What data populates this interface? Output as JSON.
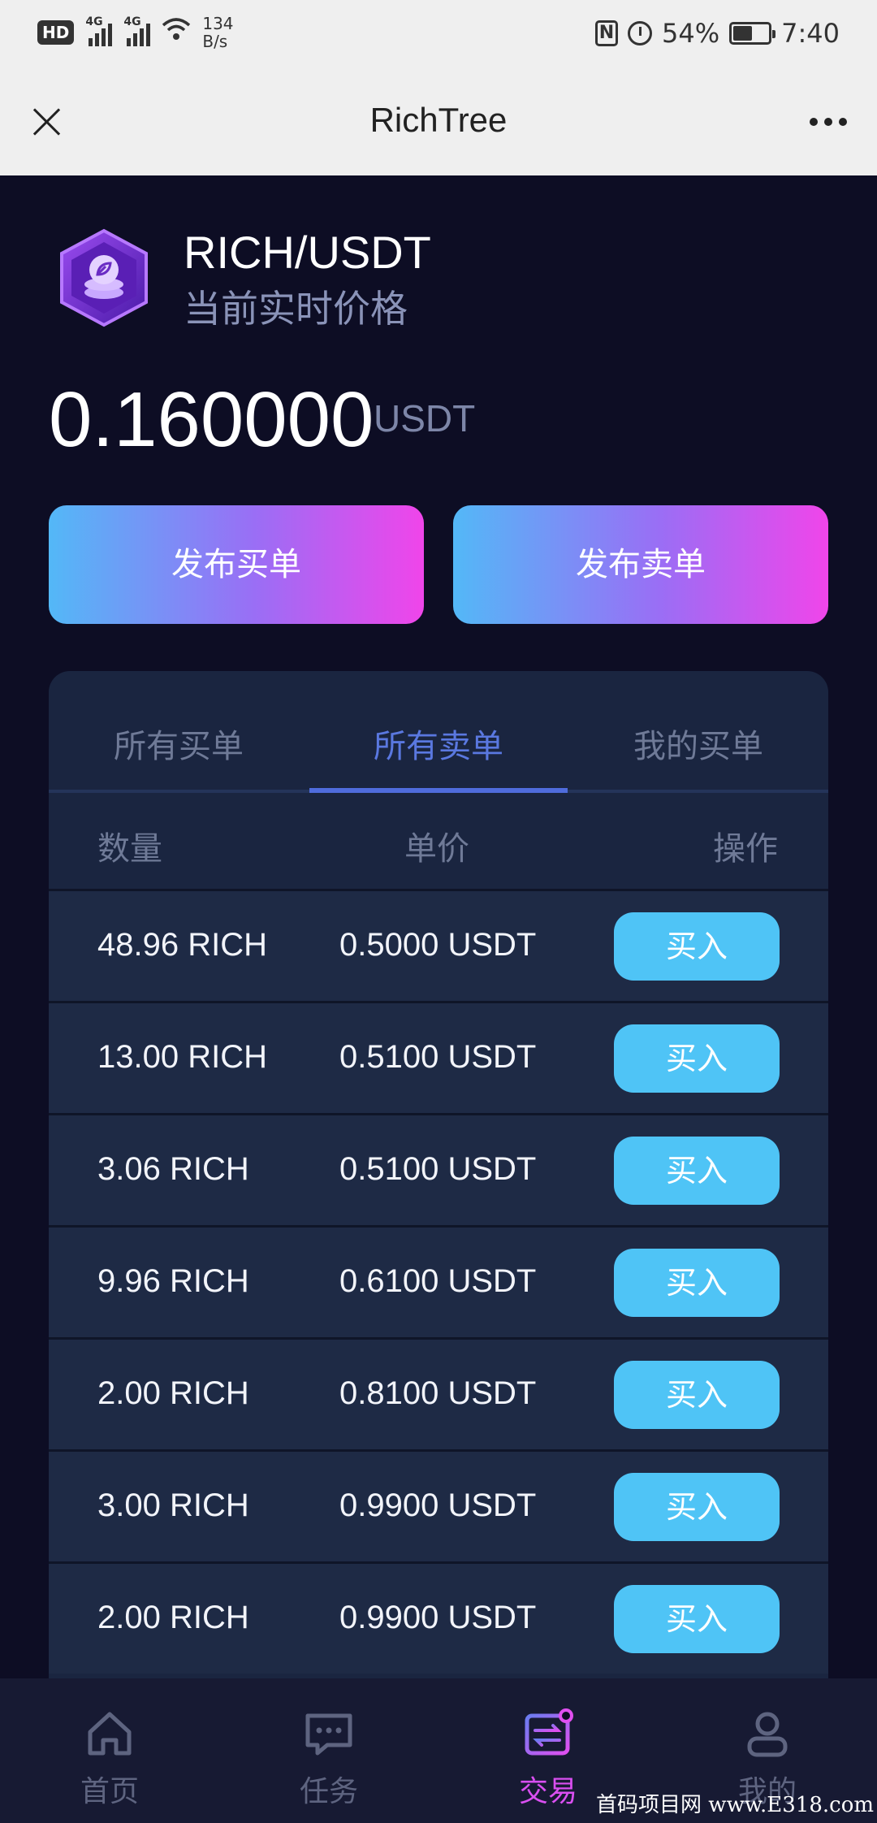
{
  "status_bar": {
    "hd": "HD",
    "net_type_1": "4G",
    "net_type_2": "4G",
    "net_speed_value": "134",
    "net_speed_unit": "B/s",
    "nfc": "N",
    "battery_percent": "54%",
    "battery_level": 0.54,
    "time": "7:40"
  },
  "titlebar": {
    "title": "RichTree"
  },
  "header": {
    "pair": "RICH/USDT",
    "subtitle": "当前实时价格",
    "price": "0.160000",
    "price_unit": "USDT"
  },
  "actions": {
    "buy_label": "发布买单",
    "sell_label": "发布卖单"
  },
  "tabs": [
    {
      "label": "所有买单",
      "active": false
    },
    {
      "label": "所有卖单",
      "active": true
    },
    {
      "label": "我的买单",
      "active": false
    }
  ],
  "table": {
    "headers": {
      "qty": "数量",
      "price": "单价",
      "action": "操作"
    },
    "rows": [
      {
        "qty": "48.96 RICH",
        "price": "0.5000 USDT",
        "action": "买入"
      },
      {
        "qty": "13.00 RICH",
        "price": "0.5100 USDT",
        "action": "买入"
      },
      {
        "qty": "3.06 RICH",
        "price": "0.5100 USDT",
        "action": "买入"
      },
      {
        "qty": "9.96 RICH",
        "price": "0.6100 USDT",
        "action": "买入"
      },
      {
        "qty": "2.00 RICH",
        "price": "0.8100 USDT",
        "action": "买入"
      },
      {
        "qty": "3.00 RICH",
        "price": "0.9900 USDT",
        "action": "买入"
      },
      {
        "qty": "2.00 RICH",
        "price": "0.9900 USDT",
        "action": "买入"
      }
    ]
  },
  "bottom_nav": [
    {
      "label": "首页",
      "icon": "home-icon",
      "active": false
    },
    {
      "label": "任务",
      "icon": "chat-icon",
      "active": false
    },
    {
      "label": "交易",
      "icon": "exchange-icon",
      "active": true
    },
    {
      "label": "我的",
      "icon": "user-icon",
      "active": false
    }
  ],
  "watermark": "首码项目网 www.E318.com",
  "colors": {
    "background": "#0d0d24",
    "card": "#1a2540",
    "accent_tab": "#5a78e0",
    "buy_button": "#4fc4f6",
    "gradient_start": "#53b8f7",
    "gradient_end": "#f045ea",
    "nav_active": "#d94ff0"
  }
}
